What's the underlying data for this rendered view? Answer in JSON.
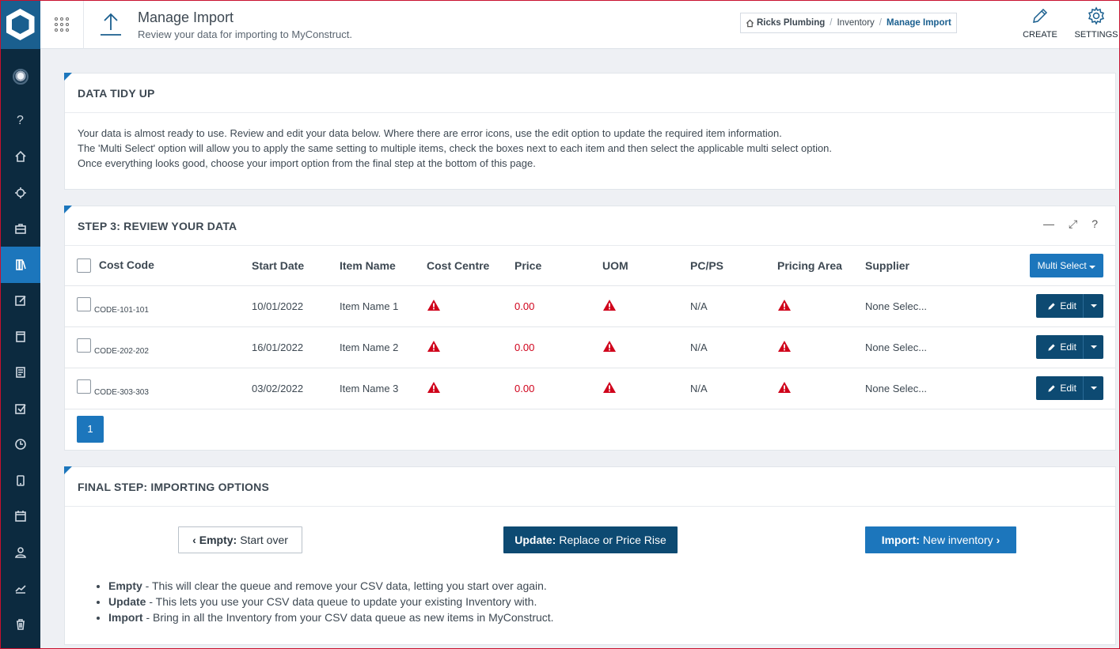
{
  "header": {
    "title": "Manage Import",
    "subtitle": "Review your data for importing to MyConstruct.",
    "breadcrumb": [
      "Ricks Plumbing",
      "Inventory",
      "Manage Import"
    ],
    "actions": [
      {
        "label": "CREATE",
        "icon": "pencil-icon"
      },
      {
        "label": "SETTINGS",
        "icon": "gear-icon"
      }
    ]
  },
  "sidebar": {
    "items": [
      {
        "name": "help",
        "icon": "question-icon"
      },
      {
        "name": "home",
        "icon": "home-icon"
      },
      {
        "name": "target",
        "icon": "crosshair-icon"
      },
      {
        "name": "briefcase",
        "icon": "briefcase-icon"
      },
      {
        "name": "inventory",
        "icon": "books-icon",
        "active": true
      },
      {
        "name": "edit",
        "icon": "edit-icon"
      },
      {
        "name": "calendar",
        "icon": "calendar-icon"
      },
      {
        "name": "documents",
        "icon": "document-icon"
      },
      {
        "name": "tasks",
        "icon": "checkbox-icon"
      },
      {
        "name": "time",
        "icon": "clock-icon"
      },
      {
        "name": "mobile",
        "icon": "mobile-icon"
      },
      {
        "name": "schedule",
        "icon": "calendar2-icon"
      },
      {
        "name": "user",
        "icon": "user-icon"
      },
      {
        "name": "reports",
        "icon": "chart-icon"
      },
      {
        "name": "trash",
        "icon": "trash-icon"
      }
    ]
  },
  "tidy": {
    "title": "DATA TIDY UP",
    "lines": [
      "Your data is almost ready to use. Review and edit your data below. Where there are error icons, use the edit option to update the required item information.",
      "The 'Multi Select' option will allow you to apply the same setting to multiple items, check the boxes next to each item and then select the applicable multi select option.",
      "Once everything looks good, choose your import option from the final step at the bottom of this page."
    ]
  },
  "review": {
    "title": "STEP 3: REVIEW YOUR DATA",
    "tools": [
      "—",
      "⤢",
      "?"
    ],
    "columns": [
      "Cost Code",
      "Start Date",
      "Item Name",
      "Cost Centre",
      "Price",
      "UOM",
      "PC/PS",
      "Pricing Area",
      "Supplier"
    ],
    "multi_select_label": "Multi Select",
    "edit_label": "Edit",
    "rows": [
      {
        "code": "CODE-101-101",
        "start": "10/01/2022",
        "item": "Item Name 1",
        "price": "0.00",
        "pcps": "N/A",
        "supplier": "None Selec..."
      },
      {
        "code": "CODE-202-202",
        "start": "16/01/2022",
        "item": "Item Name 2",
        "price": "0.00",
        "pcps": "N/A",
        "supplier": "None Selec..."
      },
      {
        "code": "CODE-303-303",
        "start": "03/02/2022",
        "item": "Item Name 3",
        "price": "0.00",
        "pcps": "N/A",
        "supplier": "None Selec..."
      }
    ],
    "page": "1"
  },
  "final": {
    "title": "FINAL STEP: IMPORTING OPTIONS",
    "empty": {
      "bold": "Empty:",
      "rest": "Start over"
    },
    "update": {
      "bold": "Update:",
      "rest": "Replace or Price Rise"
    },
    "import": {
      "bold": "Import:",
      "rest": "New inventory"
    },
    "notes": [
      {
        "bold": "Empty",
        "rest": " - This will clear the queue and remove your CSV data, letting you start over again."
      },
      {
        "bold": "Update",
        "rest": " - This lets you use your CSV data queue to update your existing Inventory with."
      },
      {
        "bold": "Import",
        "rest": " - Bring in all the Inventory from your CSV data queue as new items in MyConstruct."
      }
    ]
  },
  "colors": {
    "primary": "#1c76bc",
    "dark": "#0d4a72",
    "sidebar": "#0c2a3f",
    "error": "#d0021b"
  }
}
